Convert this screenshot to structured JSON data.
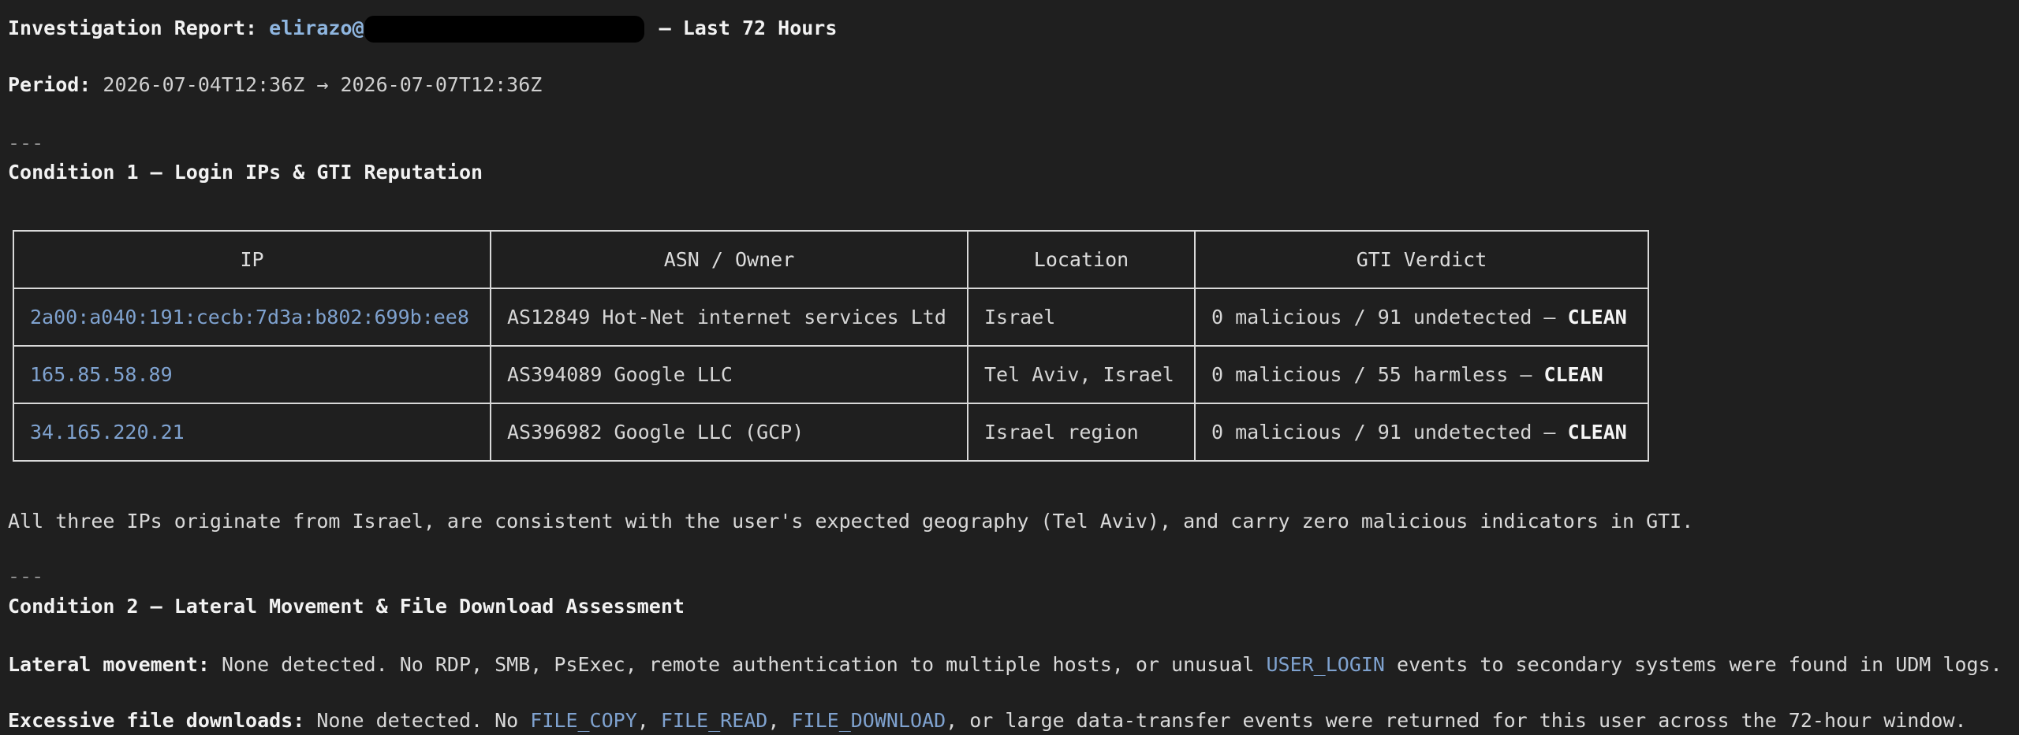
{
  "report": {
    "title_prefix": "Investigation Report:",
    "user": "elirazo@",
    "title_suffix": "— Last 72 Hours",
    "period_label": "Period:",
    "period_value": "2026-07-04T12:36Z → 2026-07-07T12:36Z",
    "divider1": "---",
    "condition1_heading": "Condition 1 — Login IPs & GTI Reputation",
    "table": {
      "headers": [
        "IP",
        "ASN / Owner",
        "Location",
        "GTI Verdict"
      ],
      "rows": [
        {
          "ip": "2a00:a040:191:cecb:7d3a:b802:699b:ee8",
          "asn": "AS12849 Hot-Net internet services Ltd",
          "location": "Israel",
          "verdict": "0 malicious / 91 undetected —",
          "status": "CLEAN"
        },
        {
          "ip": "165.85.58.89",
          "asn": "AS394089 Google LLC",
          "location": "Tel Aviv, Israel",
          "verdict": "0 malicious / 55 harmless —",
          "status": "CLEAN"
        },
        {
          "ip": "34.165.220.21",
          "asn": "AS396982 Google LLC (GCP)",
          "location": "Israel region",
          "verdict": "0 malicious / 91 undetected —",
          "status": "CLEAN"
        }
      ]
    },
    "summary": "All three IPs originate from Israel, are consistent with the user's expected geography (Tel Aviv), and carry zero malicious indicators in GTI.",
    "divider2": "---",
    "condition2_heading": "Condition 2 — Lateral Movement & File Download Assessment",
    "lateral": {
      "label": "Lateral movement:",
      "text_before": "None detected. No RDP, SMB, PsExec, remote authentication to multiple hosts, or unusual",
      "code": "USER_LOGIN",
      "text_after": "events to secondary systems were found in UDM logs."
    },
    "downloads": {
      "label": "Excessive file downloads:",
      "text_before": "None detected. No",
      "code1": "FILE_COPY",
      "sep1": ",",
      "code2": "FILE_READ",
      "sep2": ",",
      "code3": "FILE_DOWNLOAD",
      "text_after": ", or large data-transfer events were returned for this user across the 72-hour window."
    }
  }
}
